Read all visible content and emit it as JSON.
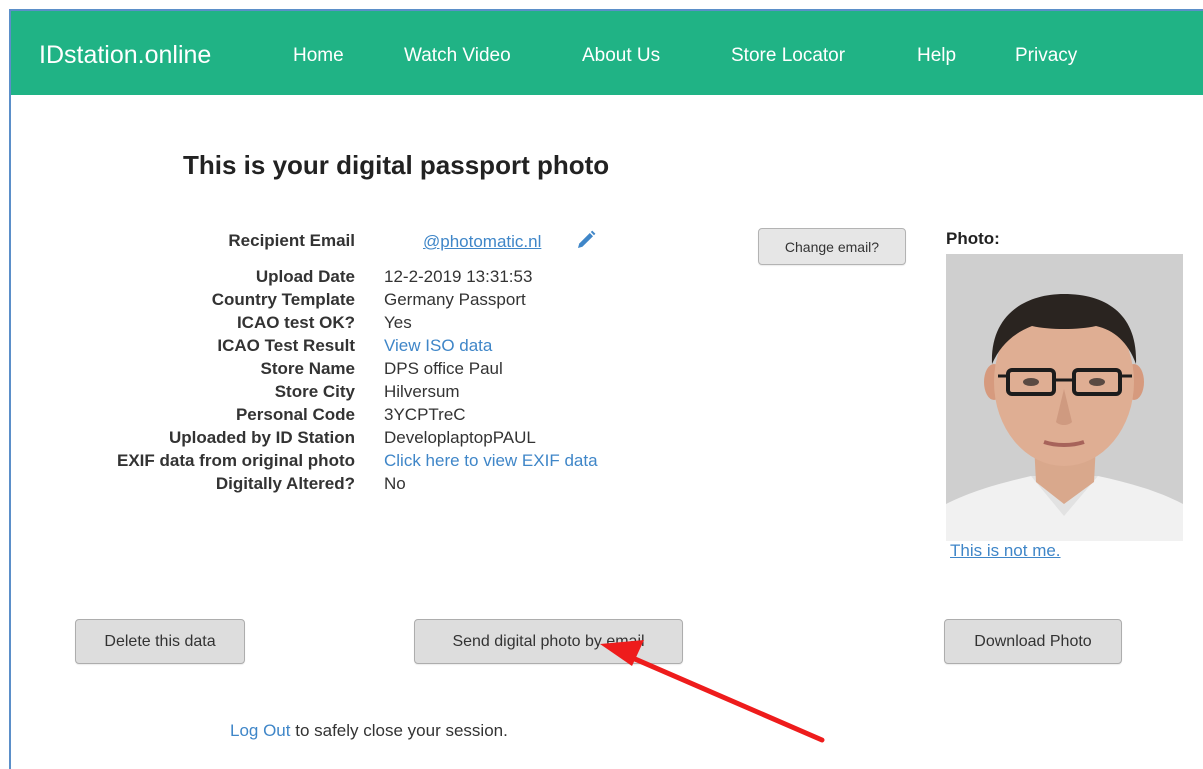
{
  "nav": {
    "brand": "IDstation.online",
    "links": [
      "Home",
      "Watch Video",
      "About Us",
      "Store Locator",
      "Help",
      "Privacy"
    ]
  },
  "page": {
    "title": "This is your digital passport photo"
  },
  "details": {
    "recipient_email_label": "Recipient Email",
    "recipient_email_value": "@photomatic.nl",
    "change_email_button": "Change email?",
    "rows": [
      {
        "label": "Upload Date",
        "value": "12-2-2019 13:31:53"
      },
      {
        "label": "Country Template",
        "value": "Germany Passport"
      },
      {
        "label": "ICAO test OK?",
        "value": "Yes"
      },
      {
        "label": "ICAO Test Result",
        "value": "View ISO data"
      },
      {
        "label": "Store Name",
        "value": "DPS office Paul"
      },
      {
        "label": "Store City",
        "value": "Hilversum"
      },
      {
        "label": "Personal Code",
        "value": "3YCPTreC"
      },
      {
        "label": "Uploaded by ID Station",
        "value": "DeveloplaptopPAUL"
      },
      {
        "label": "EXIF data from original photo",
        "value": "Click here to view EXIF data"
      },
      {
        "label": "Digitally Altered?",
        "value": "No"
      }
    ]
  },
  "photo": {
    "label": "Photo:",
    "not_me_link": "This is not me."
  },
  "actions": {
    "delete": "Delete this data",
    "send_email": "Send digital photo by email",
    "download": "Download Photo"
  },
  "footer": {
    "logout_link": "Log Out",
    "logout_text": " to safely close your session."
  },
  "colors": {
    "navbar": "#20b385",
    "link": "#3f86c8",
    "annotation_arrow": "#ee1c1c"
  }
}
